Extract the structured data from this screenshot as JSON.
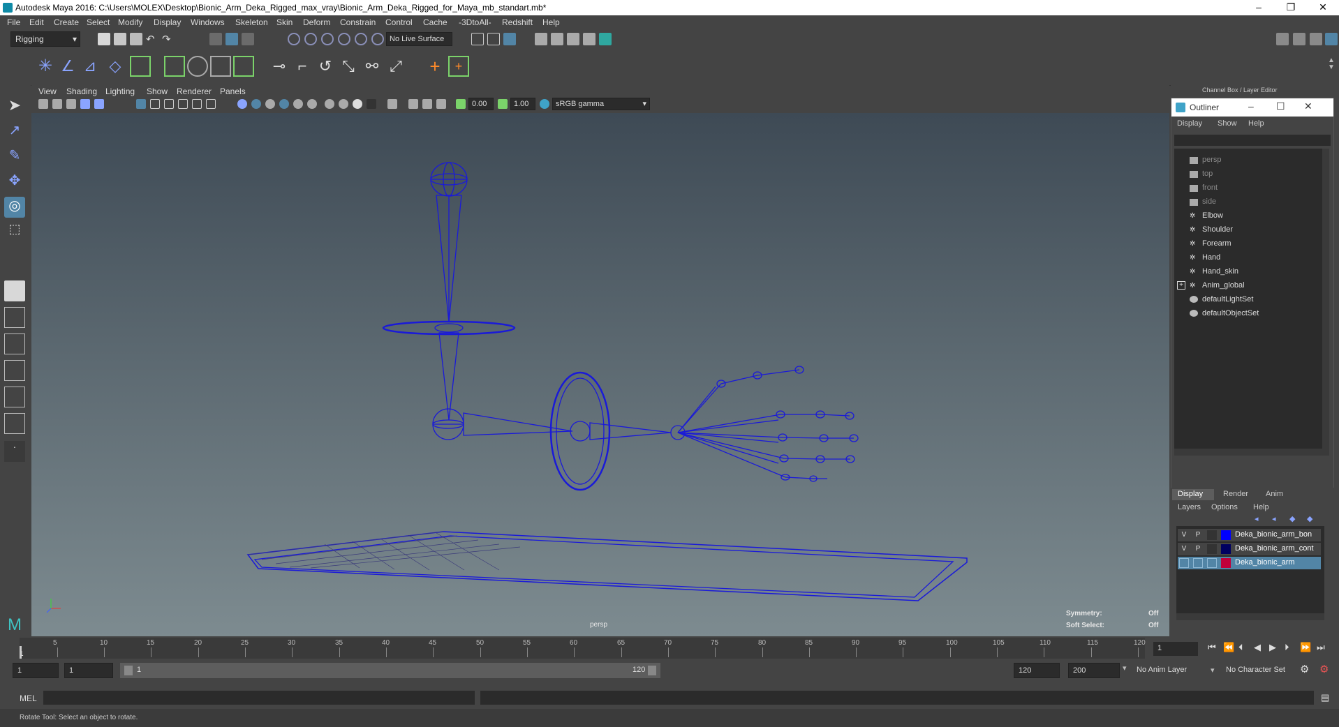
{
  "window": {
    "title": "Autodesk Maya 2016: C:\\Users\\MOLEX\\Desktop\\Bionic_Arm_Deka_Rigged_max_vray\\Bionic_Arm_Deka_Rigged_for_Maya_mb_standart.mb*",
    "minimize": "–",
    "restore": "❐",
    "close": "✕"
  },
  "menubar": [
    "File",
    "Edit",
    "Create",
    "Select",
    "Modify",
    "Display",
    "Windows",
    "Skeleton",
    "Skin",
    "Deform",
    "Constrain",
    "Control",
    "Cache",
    "-3DtoAll-",
    "Redshift",
    "Help"
  ],
  "statusline": {
    "menuset": "Rigging",
    "live_surface": "No Live Surface"
  },
  "viewport": {
    "menu": [
      "View",
      "Shading",
      "Lighting",
      "Show",
      "Renderer",
      "Panels"
    ],
    "exposure": "0.00",
    "gamma": "1.00",
    "colorspace": "sRGB gamma",
    "camera_label": "persp",
    "hud": {
      "symmetry_label": "Symmetry:",
      "symmetry_value": "Off",
      "soft_select_label": "Soft Select:",
      "soft_select_value": "Off"
    }
  },
  "channelbox": {
    "title": "Channel Box / Layer Editor"
  },
  "outliner": {
    "title": "Outliner",
    "menu": [
      "Display",
      "Show",
      "Help"
    ],
    "items": [
      {
        "label": "persp",
        "dim": true,
        "icon": "camera-icon"
      },
      {
        "label": "top",
        "dim": true,
        "icon": "camera-icon"
      },
      {
        "label": "front",
        "dim": true,
        "icon": "camera-icon"
      },
      {
        "label": "side",
        "dim": true,
        "icon": "camera-icon"
      },
      {
        "label": "Elbow",
        "dim": false,
        "icon": "transform-icon"
      },
      {
        "label": "Shoulder",
        "dim": false,
        "icon": "transform-icon"
      },
      {
        "label": "Forearm",
        "dim": false,
        "icon": "transform-icon"
      },
      {
        "label": "Hand",
        "dim": false,
        "icon": "transform-icon"
      },
      {
        "label": "Hand_skin",
        "dim": false,
        "icon": "transform-icon"
      },
      {
        "label": "Anim_global",
        "dim": false,
        "icon": "transform-icon",
        "expandable": true
      },
      {
        "label": "defaultLightSet",
        "dim": false,
        "icon": "set-icon"
      },
      {
        "label": "defaultObjectSet",
        "dim": false,
        "icon": "set-icon"
      }
    ]
  },
  "layers": {
    "tabs": [
      "Display",
      "Render",
      "Anim"
    ],
    "menu": [
      "Layers",
      "Options",
      "Help"
    ],
    "rows": [
      {
        "v": "V",
        "p": "P",
        "name": "Deka_bionic_arm_bon",
        "color": "#0000ff",
        "selected": false
      },
      {
        "v": "V",
        "p": "P",
        "name": "Deka_bionic_arm_cont",
        "color": "#000060",
        "selected": false
      },
      {
        "v": "",
        "p": "",
        "name": "Deka_bionic_arm",
        "color": "#c0003a",
        "selected": true
      }
    ]
  },
  "timeslider": {
    "ticks": [
      "5",
      "10",
      "15",
      "20",
      "25",
      "30",
      "35",
      "40",
      "45",
      "50",
      "55",
      "60",
      "65",
      "70",
      "75",
      "80",
      "85",
      "90",
      "95",
      "100",
      "105",
      "110",
      "115",
      "120"
    ],
    "start_tick": "1",
    "current_frame": "1"
  },
  "rangeslider": {
    "start": "1",
    "start2": "1",
    "range_start": "1",
    "range_end": "120",
    "end": "120",
    "end2": "200",
    "anim_layer": "No Anim Layer",
    "char_set": "No Character Set"
  },
  "cmdline": {
    "label": "MEL"
  },
  "helpline": {
    "text": "Rotate Tool: Select an object to rotate."
  },
  "colors": {
    "bone": "#1a1ad8",
    "selection": "#5285a6"
  }
}
